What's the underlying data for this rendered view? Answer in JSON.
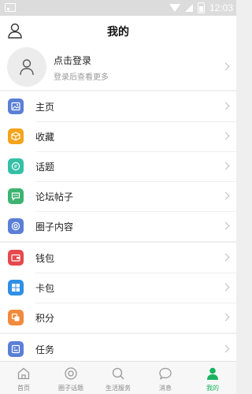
{
  "status_bar": {
    "time": "12:03"
  },
  "header": {
    "title": "我的"
  },
  "profile": {
    "login_text": "点击登录",
    "hint_text": "登录后查看更多"
  },
  "menu_groups": [
    [
      {
        "label": "主页",
        "icon": "image-icon",
        "color": "#5b7fd6"
      },
      {
        "label": "收藏",
        "icon": "box-icon",
        "color": "#f3a41b"
      },
      {
        "label": "话题",
        "icon": "topic-icon",
        "color": "#35c0a6"
      },
      {
        "label": "论坛帖子",
        "icon": "chat-icon",
        "color": "#3cb371"
      },
      {
        "label": "圈子内容",
        "icon": "circle-icon",
        "color": "#5b7fd6"
      }
    ],
    [
      {
        "label": "钱包",
        "icon": "wallet-icon",
        "color": "#e5484d"
      },
      {
        "label": "卡包",
        "icon": "card-icon",
        "color": "#2f8fe6"
      },
      {
        "label": "积分",
        "icon": "points-icon",
        "color": "#f08a3c"
      }
    ],
    [
      {
        "label": "任务",
        "icon": "task-icon",
        "color": "#5b7fd6"
      }
    ]
  ],
  "tabbar": {
    "active_color": "#19b35f",
    "items": [
      {
        "label": "首页",
        "icon": "home-icon"
      },
      {
        "label": "圈子话题",
        "icon": "target-icon"
      },
      {
        "label": "生活服务",
        "icon": "search-icon"
      },
      {
        "label": "消息",
        "icon": "message-icon"
      },
      {
        "label": "我的",
        "icon": "person-icon",
        "active": true
      }
    ]
  }
}
